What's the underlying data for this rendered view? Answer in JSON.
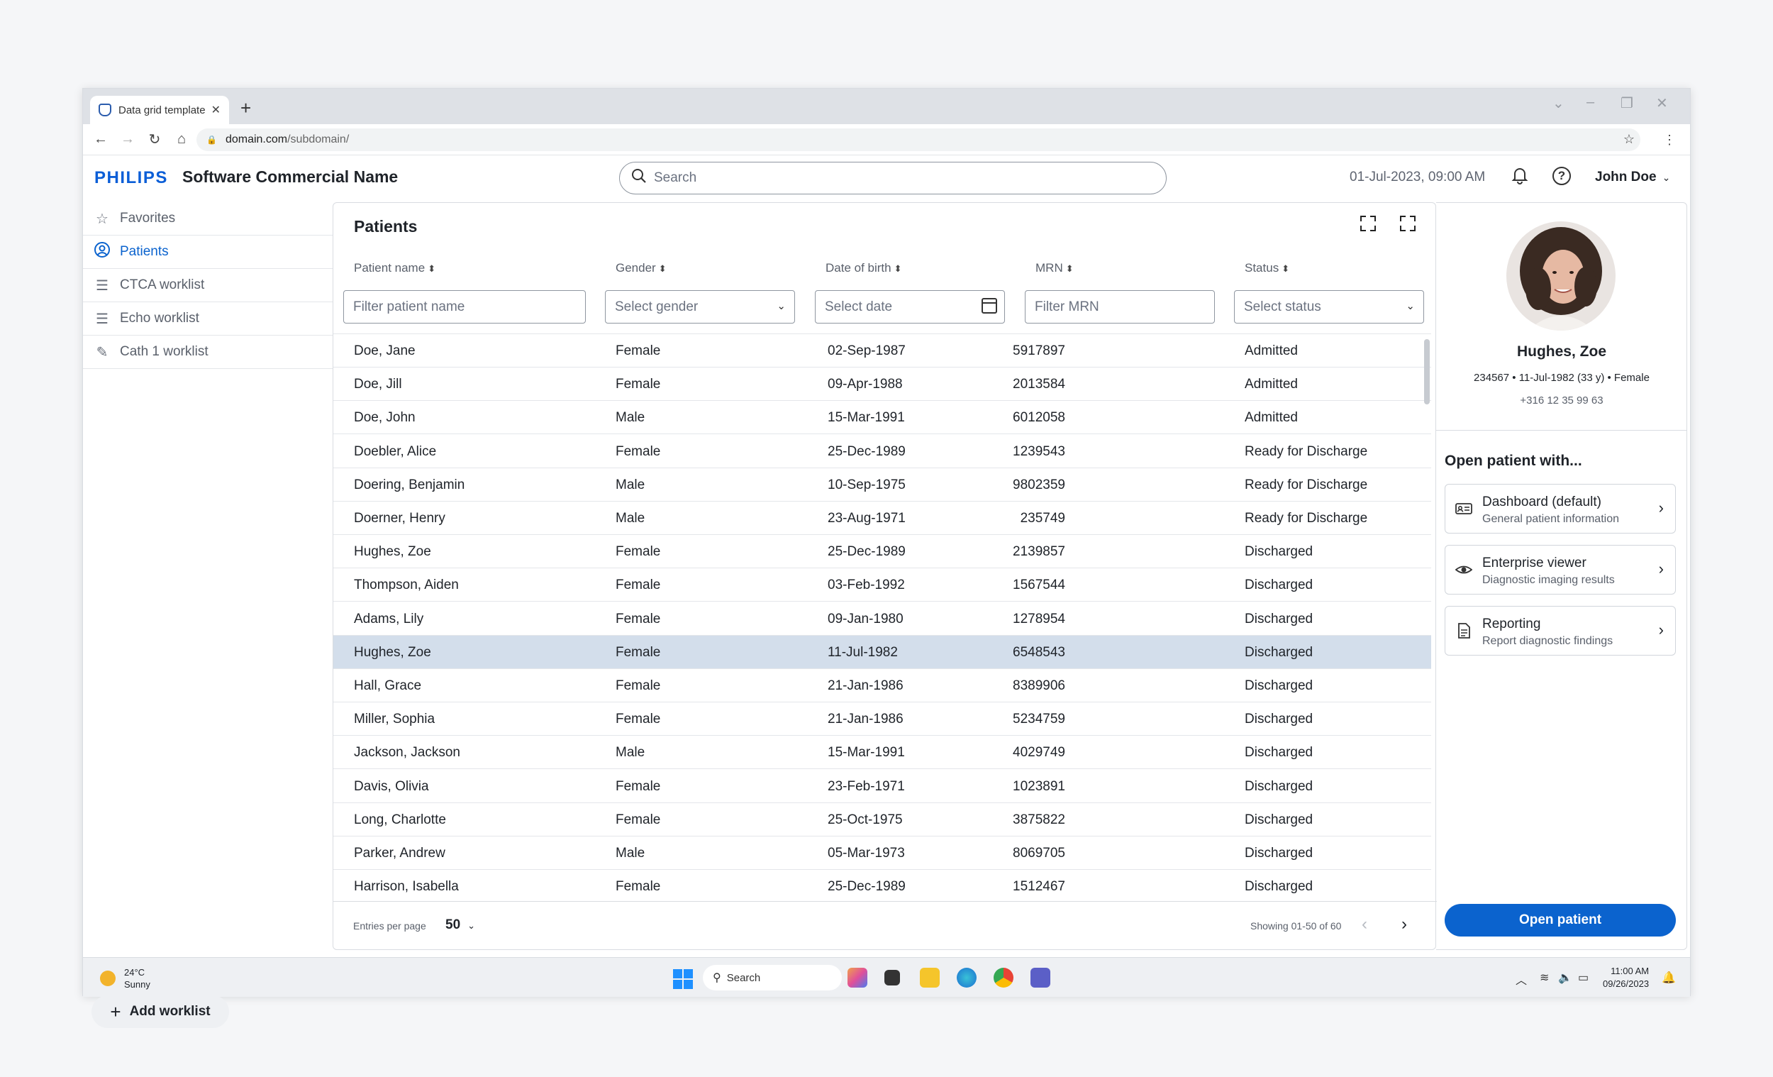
{
  "browser": {
    "tab_title": "Data grid template",
    "url_domain": "domain.com",
    "url_path": "/subdomain/"
  },
  "header": {
    "logo": "PHILIPS",
    "app_name": "Software Commercial Name",
    "search_placeholder": "Search",
    "datetime": "01-Jul-2023, 09:00 AM",
    "user": "John Doe"
  },
  "sidebar": {
    "items": [
      {
        "label": "Favorites",
        "icon": "star-icon"
      },
      {
        "label": "Patients",
        "icon": "user-circle-icon",
        "active": true
      },
      {
        "label": "CTCA worklist",
        "icon": "list-icon"
      },
      {
        "label": "Echo worklist",
        "icon": "list-icon"
      },
      {
        "label": "Cath 1 worklist",
        "icon": "cath-icon"
      }
    ],
    "add_worklist": "Add worklist"
  },
  "grid": {
    "title": "Patients",
    "columns": [
      "Patient name",
      "Gender",
      "Date of birth",
      "MRN",
      "Status"
    ],
    "filters": {
      "name": "Filter patient name",
      "gender": "Select gender",
      "dob": "Select date",
      "mrn": "Filter MRN",
      "status": "Select status"
    },
    "rows": [
      [
        "Doe, Jane",
        "Female",
        "02-Sep-1987",
        "5917897",
        "Admitted"
      ],
      [
        "Doe, Jill",
        "Female",
        "09-Apr-1988",
        "2013584",
        "Admitted"
      ],
      [
        "Doe, John",
        "Male",
        "15-Mar-1991",
        "6012058",
        "Admitted"
      ],
      [
        "Doebler, Alice",
        "Female",
        "25-Dec-1989",
        "1239543",
        "Ready for Discharge"
      ],
      [
        "Doering, Benjamin",
        "Male",
        "10-Sep-1975",
        "9802359",
        "Ready for Discharge"
      ],
      [
        "Doerner, Henry",
        "Male",
        "23-Aug-1971",
        "235749",
        "Ready for Discharge"
      ],
      [
        "Hughes, Zoe",
        "Female",
        "25-Dec-1989",
        "2139857",
        "Discharged"
      ],
      [
        "Thompson, Aiden",
        "Female",
        "03-Feb-1992",
        "1567544",
        "Discharged"
      ],
      [
        "Adams, Lily",
        "Female",
        "09-Jan-1980",
        "1278954",
        "Discharged"
      ],
      [
        "Hughes, Zoe",
        "Female",
        "11-Jul-1982",
        "6548543",
        "Discharged"
      ],
      [
        "Hall, Grace",
        "Female",
        "21-Jan-1986",
        "8389906",
        "Discharged"
      ],
      [
        "Miller, Sophia",
        "Female",
        "21-Jan-1986",
        "5234759",
        "Discharged"
      ],
      [
        "Jackson, Jackson",
        "Male",
        "15-Mar-1991",
        "4029749",
        "Discharged"
      ],
      [
        "Davis, Olivia",
        "Female",
        "23-Feb-1971",
        "1023891",
        "Discharged"
      ],
      [
        "Long, Charlotte",
        "Female",
        "25-Oct-1975",
        "3875822",
        "Discharged"
      ],
      [
        "Parker, Andrew",
        "Male",
        "05-Mar-1973",
        "8069705",
        "Discharged"
      ],
      [
        "Harrison, Isabella",
        "Female",
        "25-Dec-1989",
        "1512467",
        "Discharged"
      ]
    ],
    "selected_row": 9,
    "entries_label": "Entries per page",
    "entries_value": "50",
    "showing": "Showing 01-50 of 60"
  },
  "patient": {
    "name": "Hughes, Zoe",
    "mrn": "234567",
    "dob": "11-Jul-1982 (33 y)",
    "gender": "Female",
    "phone": "+316 12 35 99 63",
    "open_with": "Open patient with...",
    "options": [
      {
        "title": "Dashboard (default)",
        "sub": "General patient information",
        "icon": "id-card-icon"
      },
      {
        "title": "Enterprise viewer",
        "sub": "Diagnostic imaging results",
        "icon": "eye-icon"
      },
      {
        "title": "Reporting",
        "sub": "Report diagnostic findings",
        "icon": "document-icon"
      }
    ],
    "open_button": "Open patient"
  },
  "taskbar": {
    "temp": "24°C",
    "weather": "Sunny",
    "search": "Search",
    "time": "11:00 AM",
    "date": "09/26/2023"
  },
  "colors": {
    "accent": "#0b63ce",
    "selected_row": "#d3deeb",
    "logo": "#0b5ed7"
  }
}
